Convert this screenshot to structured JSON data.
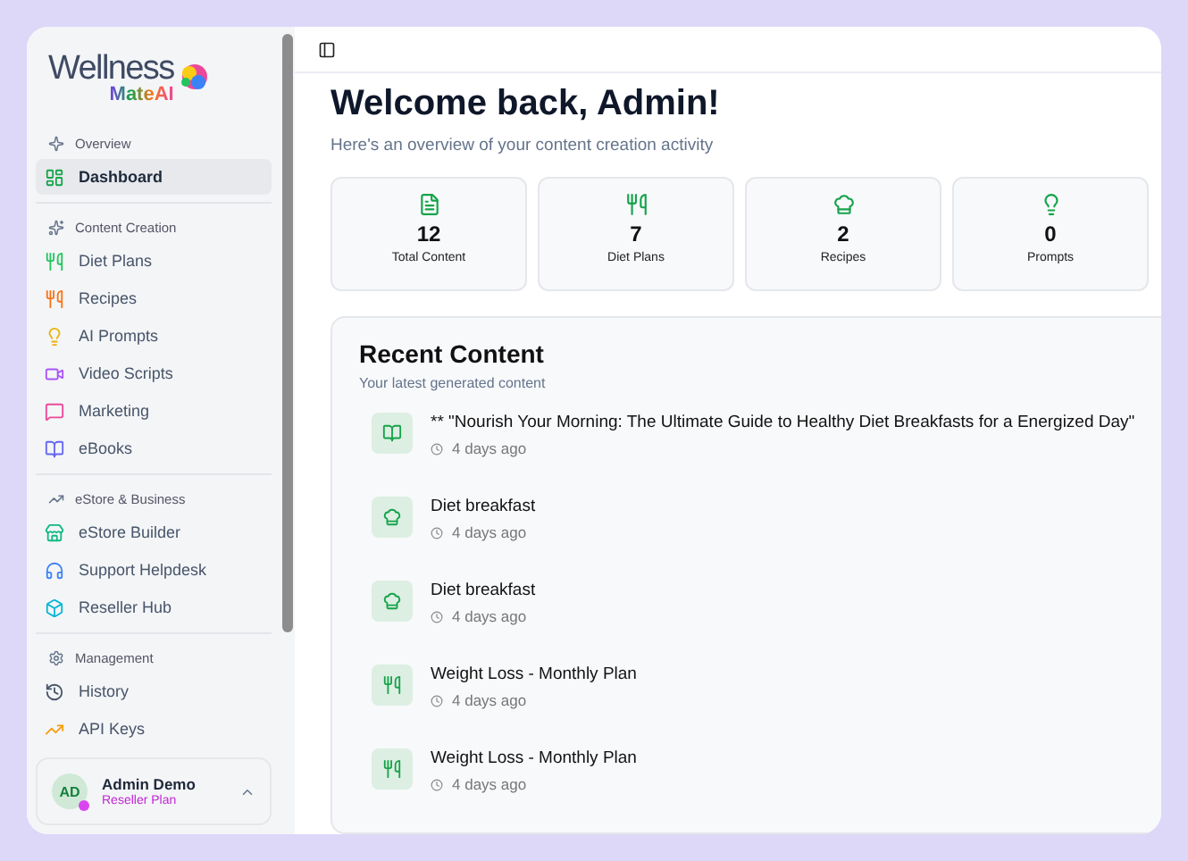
{
  "logo": {
    "word": "Wellness",
    "sub": "MateAI"
  },
  "sidebar": {
    "groups": [
      {
        "title": "Overview",
        "kind": "sparkle",
        "items": [
          {
            "label": "Dashboard",
            "kind": "dashboard",
            "color": "#16a34a",
            "selected": true
          }
        ]
      },
      {
        "title": "Content Creation",
        "kind": "sparkles",
        "items": [
          {
            "label": "Diet Plans",
            "kind": "utensils",
            "color": "#22c55e",
            "selected": false
          },
          {
            "label": "Recipes",
            "kind": "utensils",
            "color": "#f97316",
            "selected": false
          },
          {
            "label": "AI Prompts",
            "kind": "bulb",
            "color": "#eab308",
            "selected": false
          },
          {
            "label": "Video Scripts",
            "kind": "video",
            "color": "#a855f7",
            "selected": false
          },
          {
            "label": "Marketing",
            "kind": "message",
            "color": "#ec4899",
            "selected": false
          },
          {
            "label": "eBooks",
            "kind": "book",
            "color": "#6366f1",
            "selected": false
          }
        ]
      },
      {
        "title": "eStore & Business",
        "kind": "trend",
        "items": [
          {
            "label": "eStore Builder",
            "kind": "store",
            "color": "#10b981",
            "selected": false
          },
          {
            "label": "Support Helpdesk",
            "kind": "headphones",
            "color": "#3b82f6",
            "selected": false
          },
          {
            "label": "Reseller Hub",
            "kind": "box",
            "color": "#06b6d4",
            "selected": false
          }
        ]
      },
      {
        "title": "Management",
        "kind": "gear",
        "items": [
          {
            "label": "History",
            "kind": "history",
            "color": "#475569",
            "selected": false
          },
          {
            "label": "API Keys",
            "kind": "trend",
            "color": "#f59e0b",
            "selected": false
          }
        ]
      }
    ]
  },
  "user": {
    "initials": "AD",
    "name": "Admin Demo",
    "plan": "Reseller Plan"
  },
  "heading": "Welcome back, Admin!",
  "subheading": "Here's an overview of your content creation activity",
  "stats": [
    {
      "kind": "file",
      "value": "12",
      "label": "Total Content"
    },
    {
      "kind": "utensils",
      "value": "7",
      "label": "Diet Plans"
    },
    {
      "kind": "chef",
      "value": "2",
      "label": "Recipes"
    },
    {
      "kind": "bulb",
      "value": "0",
      "label": "Prompts"
    }
  ],
  "recent": {
    "title": "Recent Content",
    "subtitle": "Your latest generated content",
    "items": [
      {
        "kind": "book",
        "title": "** \"Nourish Your Morning: The Ultimate Guide to Healthy Diet Breakfasts for a Energized Day\"",
        "time": "4 days ago"
      },
      {
        "kind": "chef",
        "title": "Diet breakfast",
        "time": "4 days ago"
      },
      {
        "kind": "chef",
        "title": "Diet breakfast",
        "time": "4 days ago"
      },
      {
        "kind": "utensils",
        "title": "Weight Loss - Monthly Plan",
        "time": "4 days ago"
      },
      {
        "kind": "utensils",
        "title": "Weight Loss - Monthly Plan",
        "time": "4 days ago"
      }
    ]
  }
}
